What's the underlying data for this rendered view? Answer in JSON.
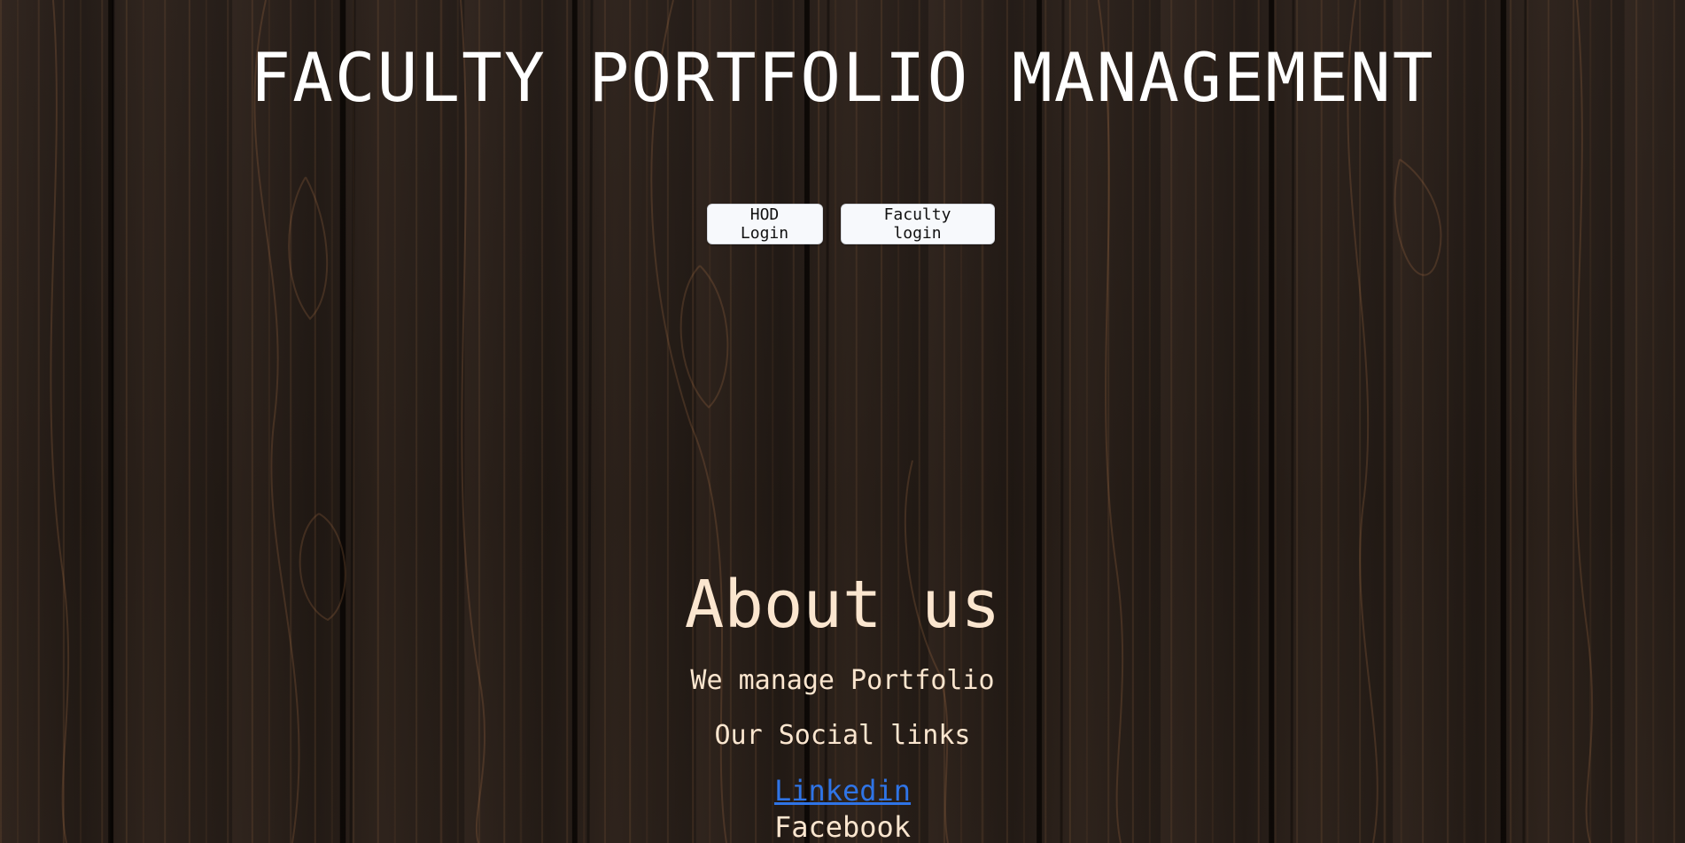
{
  "header": {
    "title": "FACULTY PORTFOLIO MANAGEMENT"
  },
  "nav": {
    "hod_login_label": "HOD Login",
    "faculty_login_label": "Faculty login"
  },
  "about": {
    "heading": "About us",
    "description": "We manage Portfolio",
    "social_heading": "Our Social links",
    "links": [
      {
        "label": "Linkedin"
      },
      {
        "label": "Facebook"
      }
    ]
  },
  "colors": {
    "title_text": "#ffffff",
    "about_text": "#fbe6cf",
    "link_blue": "#2f74e6",
    "button_bg": "#f7f9fc",
    "background_wood": "#2a221d"
  }
}
